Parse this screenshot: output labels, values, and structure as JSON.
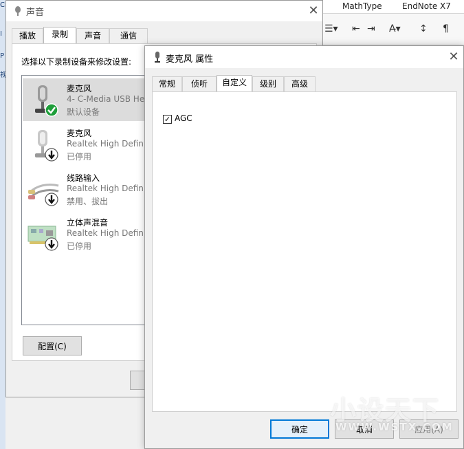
{
  "background_app": {
    "tabs": [
      "MathType",
      "EndNote X7"
    ],
    "left_sliver_chars": [
      "Ci",
      "I",
      "P",
      "视"
    ]
  },
  "sound_dialog": {
    "title": "声音",
    "tabs": [
      {
        "label": "播放",
        "active": false
      },
      {
        "label": "录制",
        "active": true
      },
      {
        "label": "声音",
        "active": false
      },
      {
        "label": "通信",
        "active": false
      }
    ],
    "instruction": "选择以下录制设备来修改设置:",
    "devices": [
      {
        "name": "麦克风",
        "driver": "4- C-Media USB He",
        "status": "默认设备",
        "icon": "microphone-icon",
        "badge": "check-badge-icon",
        "selected": true
      },
      {
        "name": "麦克风",
        "driver": "Realtek High Definit",
        "status": "已停用",
        "icon": "microphone-icon",
        "badge": "down-arrow-badge-icon",
        "selected": false
      },
      {
        "name": "线路输入",
        "driver": "Realtek High Definit",
        "status": "禁用、拔出",
        "icon": "rca-cable-icon",
        "badge": "down-arrow-badge-icon",
        "selected": false
      },
      {
        "name": "立体声混音",
        "driver": "Realtek High Definit",
        "status": "已停用",
        "icon": "sound-card-icon",
        "badge": "down-arrow-badge-icon",
        "selected": false
      }
    ],
    "configure_button": "配置(C)"
  },
  "properties_dialog": {
    "title": "麦克风 属性",
    "tabs": [
      {
        "label": "常规",
        "active": false
      },
      {
        "label": "侦听",
        "active": false
      },
      {
        "label": "自定义",
        "active": true
      },
      {
        "label": "级别",
        "active": false
      },
      {
        "label": "高级",
        "active": false
      }
    ],
    "agc": {
      "label": "AGC",
      "checked": true
    },
    "buttons": {
      "ok": "确定",
      "cancel": "取消",
      "apply": "应用(A)"
    }
  },
  "watermark": {
    "text": "小设天下",
    "sub": "WWW.WSTX.COM"
  },
  "colors": {
    "accent": "#0078d7",
    "check_green": "#1e9e3a",
    "selected_row": "#dcdcdc"
  }
}
